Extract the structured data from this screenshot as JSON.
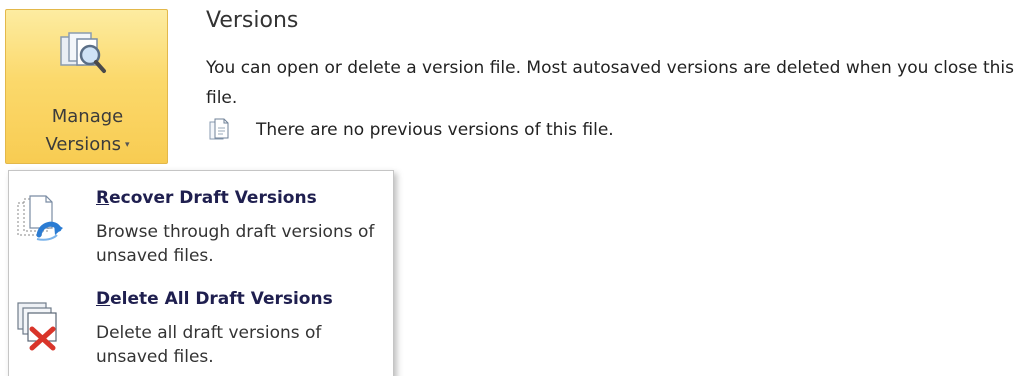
{
  "manage_button": {
    "line1": "Manage",
    "line2": "Versions",
    "icon": "manage-versions-icon",
    "dropdown_indicator": "▾"
  },
  "versions": {
    "title": "Versions",
    "description": "You can open or delete a version file. Most autosaved versions are deleted when you close this file.",
    "no_versions_text": "There are no previous versions of this file.",
    "info_icon": "document-icon"
  },
  "menu": {
    "items": [
      {
        "title_accel": "R",
        "title_rest": "ecover Draft Versions",
        "description": "Browse through draft versions of unsaved files.",
        "icon": "recover-drafts-icon"
      },
      {
        "title_accel": "D",
        "title_rest": "elete All Draft Versions",
        "description": "Delete all draft versions of unsaved files.",
        "icon": "delete-drafts-icon"
      }
    ]
  },
  "colors": {
    "button_highlight": "#fbd96c",
    "button_border": "#e3b84a",
    "delete_x": "#d9352a",
    "recover_arrow": "#2b7cd3"
  }
}
